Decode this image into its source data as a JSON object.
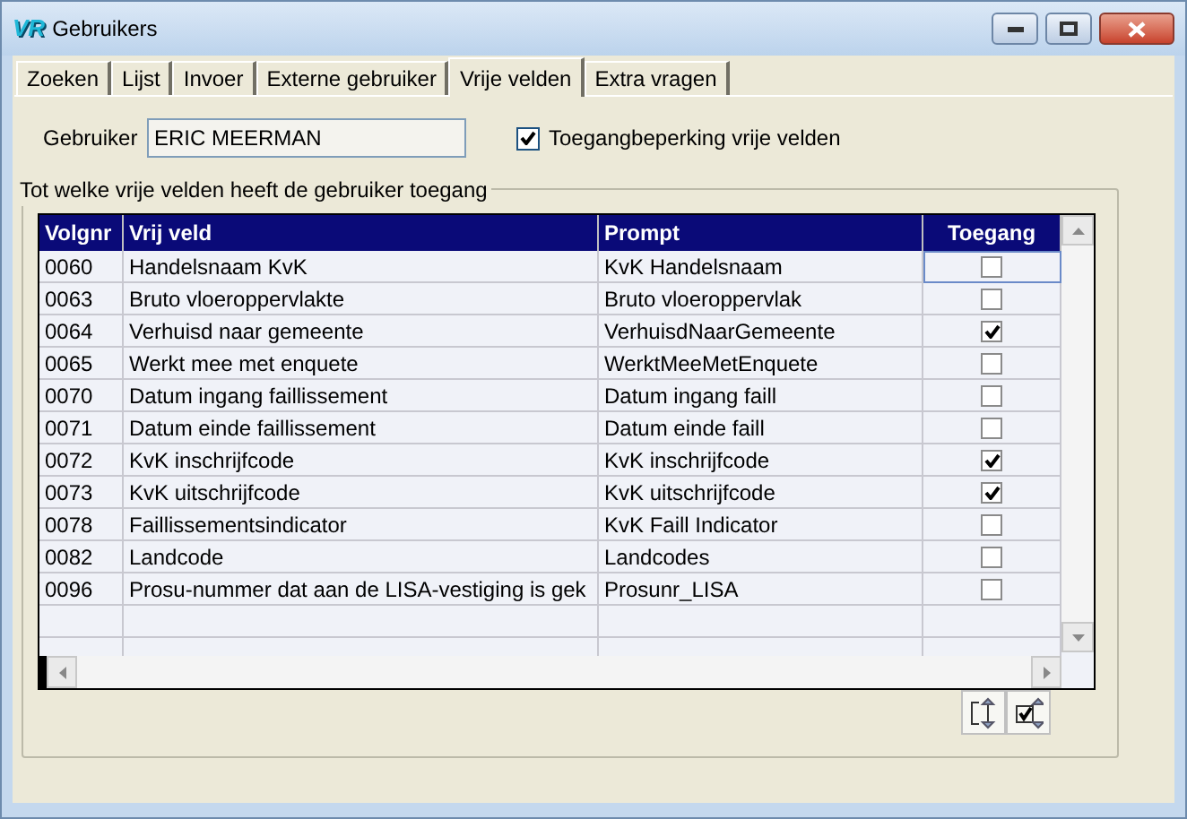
{
  "window": {
    "title": "Gebruikers",
    "logo": "VR"
  },
  "tabs": [
    {
      "label": "Zoeken",
      "selected": false
    },
    {
      "label": "Lijst",
      "selected": false
    },
    {
      "label": "Invoer",
      "selected": false
    },
    {
      "label": "Externe gebruiker",
      "selected": false
    },
    {
      "label": "Vrije velden",
      "selected": true
    },
    {
      "label": "Extra vragen",
      "selected": false
    }
  ],
  "user": {
    "label": "Gebruiker",
    "value": "ERIC MEERMAN"
  },
  "restriction": {
    "label": "Toegangbeperking vrije velden",
    "checked": true
  },
  "group": {
    "title": "Tot welke vrije velden heeft de gebruiker toegang"
  },
  "table": {
    "columns": [
      "Volgnr",
      "Vrij veld",
      "Prompt",
      "Toegang"
    ],
    "rows": [
      {
        "volgnr": "0060",
        "veld": "Handelsnaam KvK",
        "prompt": "KvK Handelsnaam",
        "checked": false,
        "selected": true
      },
      {
        "volgnr": "0063",
        "veld": "Bruto vloeroppervlakte",
        "prompt": "Bruto vloeroppervlak",
        "checked": false,
        "selected": false
      },
      {
        "volgnr": "0064",
        "veld": "Verhuisd naar gemeente",
        "prompt": "VerhuisdNaarGemeente",
        "checked": true,
        "selected": false
      },
      {
        "volgnr": "0065",
        "veld": "Werkt mee met enquete",
        "prompt": "WerktMeeMetEnquete",
        "checked": false,
        "selected": false
      },
      {
        "volgnr": "0070",
        "veld": "Datum ingang faillissement",
        "prompt": "Datum ingang faill",
        "checked": false,
        "selected": false
      },
      {
        "volgnr": "0071",
        "veld": "Datum einde faillissement",
        "prompt": "Datum einde faill",
        "checked": false,
        "selected": false
      },
      {
        "volgnr": "0072",
        "veld": "KvK inschrijfcode",
        "prompt": "KvK inschrijfcode",
        "checked": true,
        "selected": false
      },
      {
        "volgnr": "0073",
        "veld": "KvK uitschrijfcode",
        "prompt": "KvK uitschrijfcode",
        "checked": true,
        "selected": false
      },
      {
        "volgnr": "0078",
        "veld": "Faillissementsindicator",
        "prompt": "KvK Faill Indicator",
        "checked": false,
        "selected": false
      },
      {
        "volgnr": "0082",
        "veld": "Landcode",
        "prompt": "Landcodes",
        "checked": false,
        "selected": false
      },
      {
        "volgnr": "0096",
        "veld": "Prosu-nummer dat aan de LISA-vestiging is gek",
        "prompt": "Prosunr_LISA",
        "checked": false,
        "selected": false
      }
    ]
  }
}
